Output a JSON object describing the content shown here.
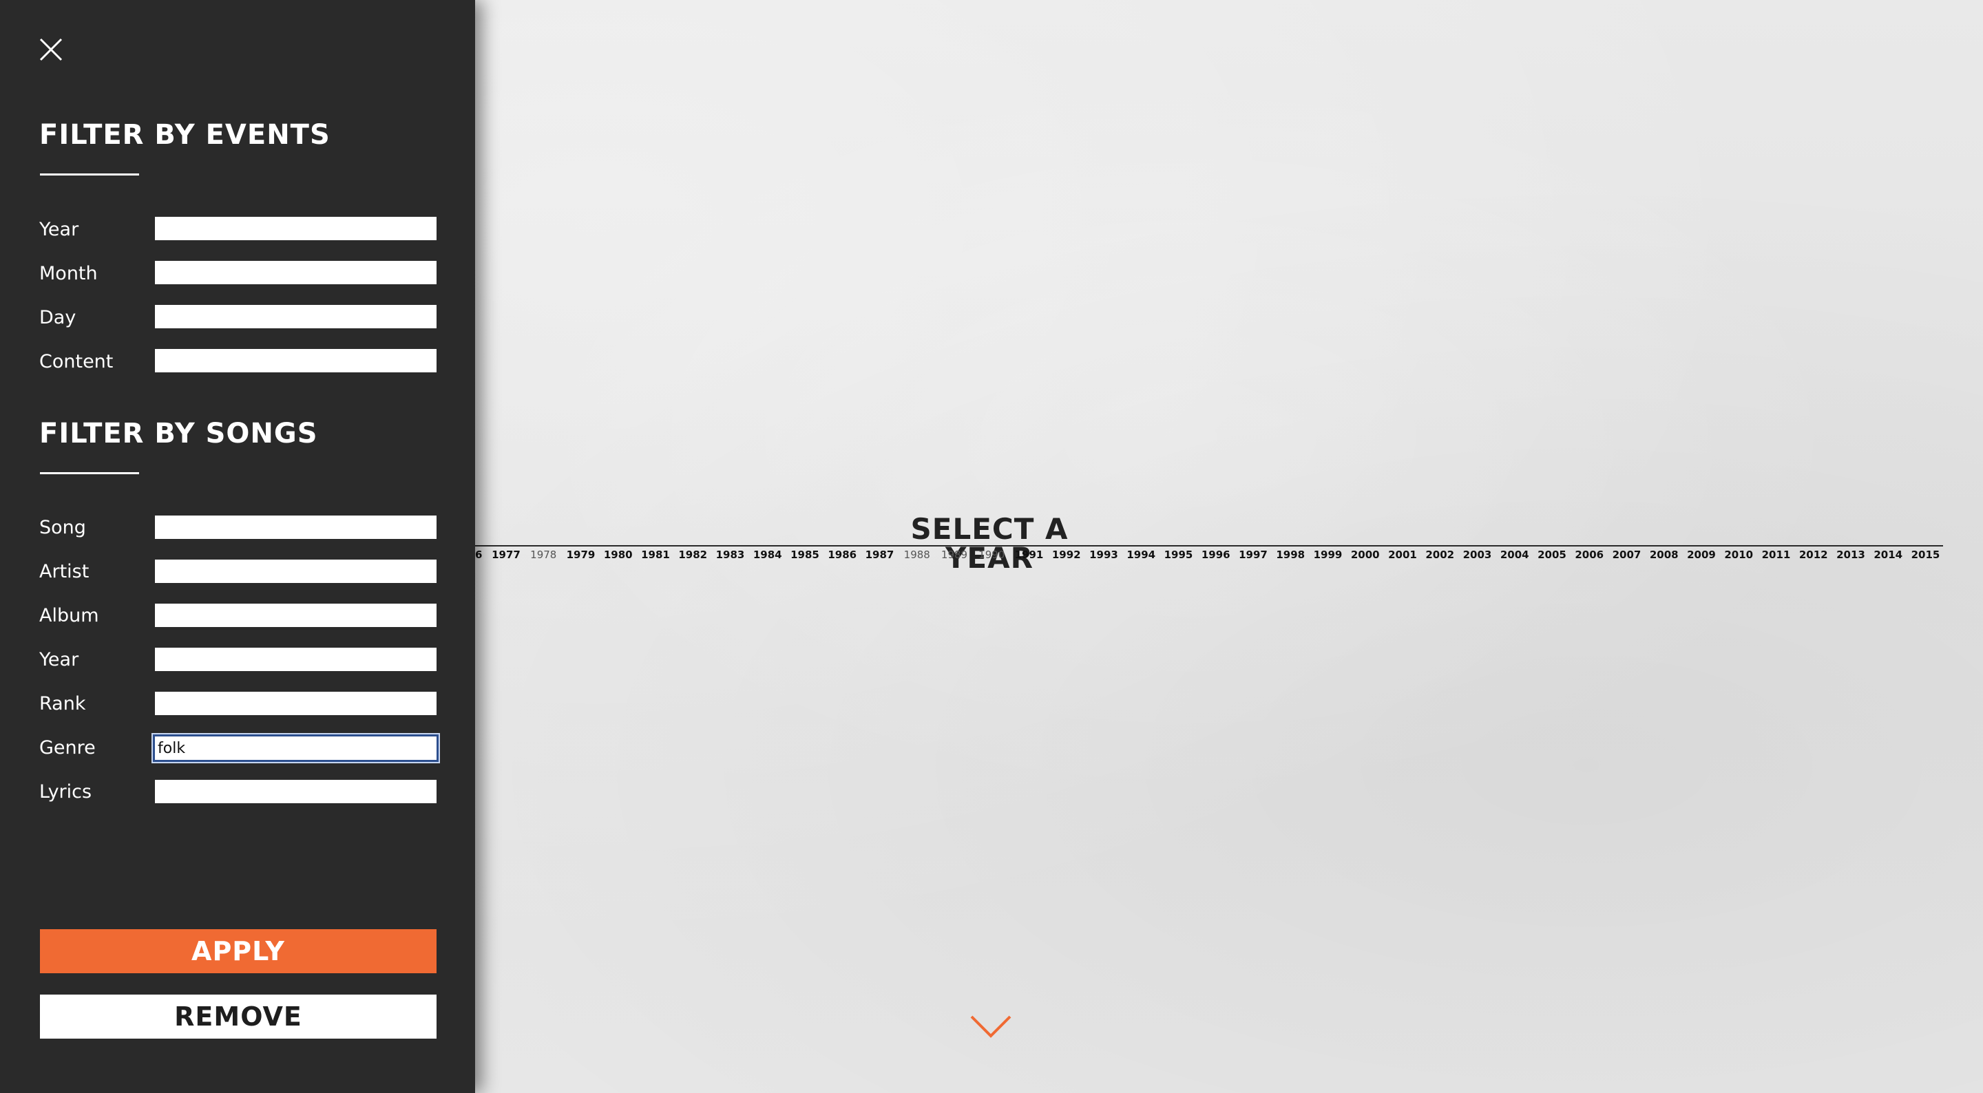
{
  "sidebar": {
    "close_icon": "close-icon",
    "events": {
      "title": "FILTER BY EVENTS",
      "fields": [
        {
          "label": "Year",
          "value": "",
          "placeholder": ""
        },
        {
          "label": "Month",
          "value": "",
          "placeholder": ""
        },
        {
          "label": "Day",
          "value": "",
          "placeholder": ""
        },
        {
          "label": "Content",
          "value": "",
          "placeholder": ""
        }
      ]
    },
    "songs": {
      "title": "FILTER BY SONGS",
      "fields": [
        {
          "label": "Song",
          "value": "",
          "placeholder": ""
        },
        {
          "label": "Artist",
          "value": "",
          "placeholder": ""
        },
        {
          "label": "Album",
          "value": "",
          "placeholder": ""
        },
        {
          "label": "Year",
          "value": "",
          "placeholder": ""
        },
        {
          "label": "Rank",
          "value": "",
          "placeholder": ""
        },
        {
          "label": "Genre",
          "value": "folk",
          "placeholder": ""
        },
        {
          "label": "Lyrics",
          "value": "",
          "placeholder": ""
        }
      ]
    },
    "apply_label": "APPLY",
    "remove_label": "REMOVE",
    "colors": {
      "panel_bg": "#2a2a2a",
      "apply_bg": "#f06a33",
      "remove_bg": "#ffffff",
      "focus_border": "#2d4f8e"
    }
  },
  "timeline": {
    "title": "SELECT A YEAR",
    "partial_year_fragment": "6",
    "years": [
      "1977",
      "1978",
      "1979",
      "1980",
      "1981",
      "1982",
      "1983",
      "1984",
      "1985",
      "1986",
      "1987",
      "1988",
      "1989",
      "1990",
      "1991",
      "1992",
      "1993",
      "1994",
      "1995",
      "1996",
      "1997",
      "1998",
      "1999",
      "2000",
      "2001",
      "2002",
      "2003",
      "2004",
      "2005",
      "2006",
      "2007",
      "2008",
      "2009",
      "2010",
      "2011",
      "2012",
      "2013",
      "2014",
      "2015"
    ],
    "faded_years": [
      "1978",
      "1988",
      "1989",
      "1990"
    ],
    "scroll_icon": "chevron-down-icon",
    "accent_color": "#f06a33"
  }
}
